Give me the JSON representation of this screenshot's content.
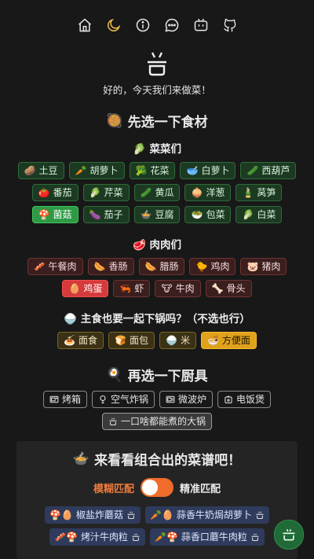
{
  "nav": {
    "icons": [
      "home-icon",
      "moon-icon",
      "info-icon",
      "message-icon",
      "bilibili-icon",
      "github-icon"
    ]
  },
  "header": {
    "subtitle": "好的，今天我们来做菜！"
  },
  "ingredients_section": {
    "title": "先选一下食材",
    "emoji": "🥘"
  },
  "vegetables": {
    "title": "🥬 菜菜们",
    "items": [
      {
        "emoji": "🥔",
        "label": "土豆",
        "selected": false
      },
      {
        "emoji": "🥕",
        "label": "胡萝卜",
        "selected": false
      },
      {
        "emoji": "🥦",
        "label": "花菜",
        "selected": false
      },
      {
        "emoji": "🥣",
        "label": "白萝卜",
        "selected": false
      },
      {
        "emoji": "🥒",
        "label": "西葫芦",
        "selected": false
      },
      {
        "emoji": "🍅",
        "label": "番茄",
        "selected": false
      },
      {
        "emoji": "🥬",
        "label": "芹菜",
        "selected": false
      },
      {
        "emoji": "🥒",
        "label": "黄瓜",
        "selected": false
      },
      {
        "emoji": "🧅",
        "label": "洋葱",
        "selected": false
      },
      {
        "emoji": "🎍",
        "label": "莴笋",
        "selected": false
      },
      {
        "emoji": "🍄",
        "label": "菌菇",
        "selected": true
      },
      {
        "emoji": "🍆",
        "label": "茄子",
        "selected": false
      },
      {
        "emoji": "🍲",
        "label": "豆腐",
        "selected": false
      },
      {
        "emoji": "🥗",
        "label": "包菜",
        "selected": false
      },
      {
        "emoji": "🥬",
        "label": "白菜",
        "selected": false
      }
    ]
  },
  "meats": {
    "title": "🥩 肉肉们",
    "items": [
      {
        "emoji": "🥓",
        "label": "午餐肉",
        "selected": false
      },
      {
        "emoji": "🌭",
        "label": "香肠",
        "selected": false
      },
      {
        "emoji": "🌭",
        "label": "腊肠",
        "selected": false
      },
      {
        "emoji": "🐤",
        "label": "鸡肉",
        "selected": false
      },
      {
        "emoji": "🐷",
        "label": "猪肉",
        "selected": false
      },
      {
        "emoji": "🥚",
        "label": "鸡蛋",
        "selected": true
      },
      {
        "emoji": "🦐",
        "label": "虾",
        "selected": false
      },
      {
        "emoji": "🐮",
        "label": "牛肉",
        "selected": false
      },
      {
        "emoji": "🦴",
        "label": "骨头",
        "selected": false
      }
    ]
  },
  "staples": {
    "title": "主食也要一起下锅吗？（不选也行）",
    "emoji": "🍚",
    "items": [
      {
        "emoji": "🍝",
        "label": "面食",
        "selected": false
      },
      {
        "emoji": "🍞",
        "label": "面包",
        "selected": false
      },
      {
        "emoji": "🍚",
        "label": "米",
        "selected": false
      },
      {
        "emoji": "🍜",
        "label": "方便面",
        "selected": true
      }
    ]
  },
  "tools_section": {
    "title": "再选一下厨具",
    "emoji": "🍳",
    "items": [
      {
        "icon": "oven-icon",
        "label": "烤箱",
        "selected": false
      },
      {
        "icon": "lightbulb-icon",
        "label": "空气炸锅",
        "selected": false
      },
      {
        "icon": "microwave-icon",
        "label": "微波炉",
        "selected": false
      },
      {
        "icon": "rice-cooker-icon",
        "label": "电饭煲",
        "selected": false
      },
      {
        "icon": "pot-icon",
        "label": "一口啥都能煮的大锅",
        "selected": true
      }
    ]
  },
  "results": {
    "title": "来看看组合出的菜谱吧！",
    "emoji": "🍲",
    "mode_fuzzy": "模糊匹配",
    "mode_exact": "精准匹配",
    "fuzzy_on": true,
    "recipes": [
      {
        "emojis": "🍄🥚",
        "label": "椒盐炸蘑菇",
        "tool": "pot-icon"
      },
      {
        "emojis": "🥕🥚",
        "label": "蒜香牛奶焗胡萝卜",
        "tool": "pot-icon"
      },
      {
        "emojis": "🥓🍄",
        "label": "烤汁牛肉粒",
        "tool": "pot-icon"
      },
      {
        "emojis": "🥕🍄",
        "label": "蒜香口蘑牛肉粒",
        "tool": "pot-icon"
      }
    ]
  },
  "fab": {
    "icon": "pot-icon"
  }
}
